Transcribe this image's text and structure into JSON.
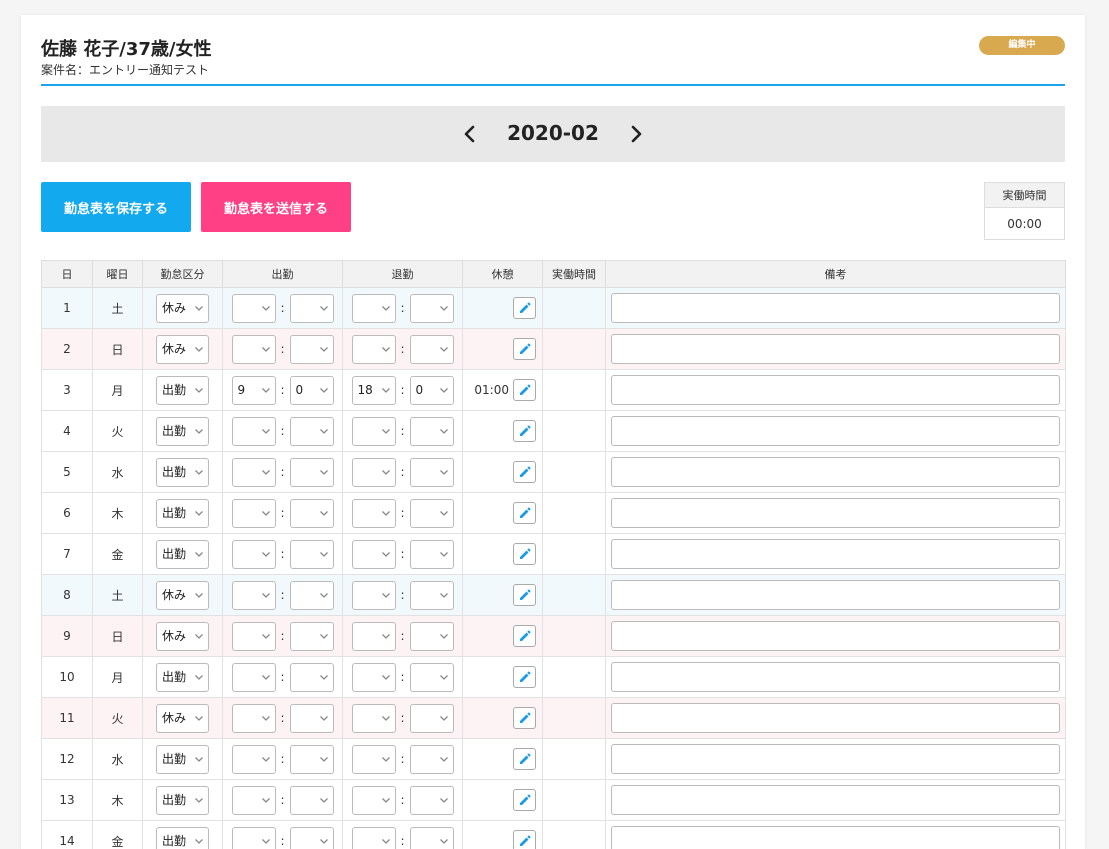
{
  "header": {
    "title": "佐藤 花子/37歳/女性",
    "subtitle": "案件名：エントリー通知テスト",
    "badge": "編集中"
  },
  "month": {
    "label": "2020-02"
  },
  "buttons": {
    "save": "勤怠表を保存する",
    "send": "勤怠表を送信する"
  },
  "summary": {
    "label": "実働時間",
    "value": "00:00"
  },
  "table": {
    "headers": [
      "日",
      "曜日",
      "勤怠区分",
      "出勤",
      "退勤",
      "休憩",
      "実働時間",
      "備考"
    ],
    "rows": [
      {
        "day": "1",
        "weekday": "土",
        "kubun": "休み",
        "start_h": "",
        "start_m": "",
        "end_h": "",
        "end_m": "",
        "break": "",
        "work": "",
        "type": "sat"
      },
      {
        "day": "2",
        "weekday": "日",
        "kubun": "休み",
        "start_h": "",
        "start_m": "",
        "end_h": "",
        "end_m": "",
        "break": "",
        "work": "",
        "type": "sun"
      },
      {
        "day": "3",
        "weekday": "月",
        "kubun": "出勤",
        "start_h": "9",
        "start_m": "0",
        "end_h": "18",
        "end_m": "0",
        "break": "01:00",
        "work": "",
        "type": ""
      },
      {
        "day": "4",
        "weekday": "火",
        "kubun": "出勤",
        "start_h": "",
        "start_m": "",
        "end_h": "",
        "end_m": "",
        "break": "",
        "work": "",
        "type": ""
      },
      {
        "day": "5",
        "weekday": "水",
        "kubun": "出勤",
        "start_h": "",
        "start_m": "",
        "end_h": "",
        "end_m": "",
        "break": "",
        "work": "",
        "type": ""
      },
      {
        "day": "6",
        "weekday": "木",
        "kubun": "出勤",
        "start_h": "",
        "start_m": "",
        "end_h": "",
        "end_m": "",
        "break": "",
        "work": "",
        "type": ""
      },
      {
        "day": "7",
        "weekday": "金",
        "kubun": "出勤",
        "start_h": "",
        "start_m": "",
        "end_h": "",
        "end_m": "",
        "break": "",
        "work": "",
        "type": ""
      },
      {
        "day": "8",
        "weekday": "土",
        "kubun": "休み",
        "start_h": "",
        "start_m": "",
        "end_h": "",
        "end_m": "",
        "break": "",
        "work": "",
        "type": "sat"
      },
      {
        "day": "9",
        "weekday": "日",
        "kubun": "休み",
        "start_h": "",
        "start_m": "",
        "end_h": "",
        "end_m": "",
        "break": "",
        "work": "",
        "type": "sun"
      },
      {
        "day": "10",
        "weekday": "月",
        "kubun": "出勤",
        "start_h": "",
        "start_m": "",
        "end_h": "",
        "end_m": "",
        "break": "",
        "work": "",
        "type": ""
      },
      {
        "day": "11",
        "weekday": "火",
        "kubun": "休み",
        "start_h": "",
        "start_m": "",
        "end_h": "",
        "end_m": "",
        "break": "",
        "work": "",
        "type": "sun"
      },
      {
        "day": "12",
        "weekday": "水",
        "kubun": "出勤",
        "start_h": "",
        "start_m": "",
        "end_h": "",
        "end_m": "",
        "break": "",
        "work": "",
        "type": ""
      },
      {
        "day": "13",
        "weekday": "木",
        "kubun": "出勤",
        "start_h": "",
        "start_m": "",
        "end_h": "",
        "end_m": "",
        "break": "",
        "work": "",
        "type": ""
      },
      {
        "day": "14",
        "weekday": "金",
        "kubun": "出勤",
        "start_h": "",
        "start_m": "",
        "end_h": "",
        "end_m": "",
        "break": "",
        "work": "",
        "type": ""
      }
    ]
  },
  "colors": {
    "accent": "#1aa3e8",
    "save_button": "#13a9ef",
    "send_button": "#ff4084",
    "badge": "#d9a94f",
    "edit_icon": "#1a9be6"
  },
  "icons": {
    "prev": "chevron-left-icon",
    "next": "chevron-right-icon",
    "edit": "pencil-icon",
    "dropdown": "chevron-down-icon"
  }
}
